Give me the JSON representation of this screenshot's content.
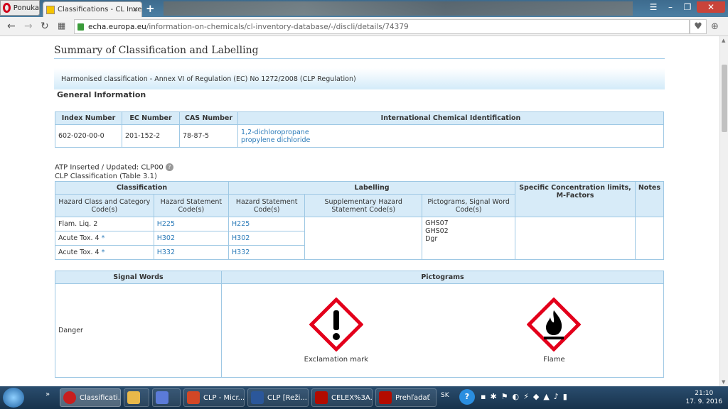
{
  "browser": {
    "opera_label": "Ponuka",
    "tab_title": "Classifications - CL Invento",
    "url_domain": "echa.europa.eu",
    "url_path": "/information-on-chemicals/cl-inventory-database/-/discli/details/74379"
  },
  "page": {
    "title": "Summary of Classification and Labelling",
    "banner": "Harmonised classification - Annex VI of Regulation (EC) No 1272/2008 (CLP Regulation)",
    "general_info_heading": "General Information",
    "general_table": {
      "headers": [
        "Index Number",
        "EC Number",
        "CAS Number",
        "International Chemical Identification"
      ],
      "row": {
        "index": "602-020-00-0",
        "ec": "201-152-2",
        "cas": "78-87-5",
        "names": [
          "1,2-dichloropropane",
          "propylene dichloride"
        ]
      }
    },
    "atp_line": "ATP Inserted / Updated: CLP00",
    "clp_line": "CLP Classification (Table 3.1)",
    "clp_table": {
      "group_headers": {
        "classification": "Classification",
        "labelling": "Labelling",
        "specific": "Specific Concentration limits, M-Factors",
        "notes": "Notes"
      },
      "sub_headers": {
        "hazard_class": "Hazard Class and Category Code(s)",
        "hazard_statement": "Hazard Statement Code(s)",
        "lab_hazard_statement": "Hazard Statement Code(s)",
        "supplementary": "Supplementary Hazard Statement Code(s)",
        "pictograms": "Pictograms, Signal Word Code(s)"
      },
      "rows": [
        {
          "class": "Flam. Liq. 2",
          "star": "",
          "hs": "H225",
          "lhs": "H225"
        },
        {
          "class": "Acute Tox. 4",
          "star": "*",
          "hs": "H302",
          "lhs": "H302"
        },
        {
          "class": "Acute Tox. 4",
          "star": "*",
          "hs": "H332",
          "lhs": "H332"
        }
      ],
      "pictogram_codes": [
        "GHS07",
        "GHS02",
        "Dgr"
      ]
    },
    "signal_table": {
      "headers": {
        "signal": "Signal Words",
        "pictograms": "Pictograms"
      },
      "signal_word": "Danger",
      "pictograms": [
        {
          "name": "Exclamation mark",
          "icon": "exclamation-mark-pictogram"
        },
        {
          "name": "Flame",
          "icon": "flame-pictogram"
        }
      ]
    }
  },
  "taskbar": {
    "items": [
      {
        "label": "Classificati...",
        "icon": "opera-icon",
        "color": "#c81e1e"
      },
      {
        "label": "",
        "icon": "folder-icon",
        "color": "#e8b84a"
      },
      {
        "label": "",
        "icon": "media-icon",
        "color": "#5b7bd8"
      },
      {
        "label": "CLP - Micr...",
        "icon": "powerpoint-icon",
        "color": "#d24726"
      },
      {
        "label": "CLP [Reži...",
        "icon": "word-icon",
        "color": "#2b579a"
      },
      {
        "label": "CELEX%3A...",
        "icon": "pdf-icon",
        "color": "#b30b00"
      },
      {
        "label": "Prehľadať",
        "icon": "acrobat-icon",
        "color": "#b30b00"
      }
    ],
    "lang": "SK",
    "time": "21:10",
    "date": "17. 9. 2016"
  },
  "colors": {
    "link": "#2a7ab8",
    "header_bg": "#d7ebf8",
    "border": "#9ec8e4"
  }
}
